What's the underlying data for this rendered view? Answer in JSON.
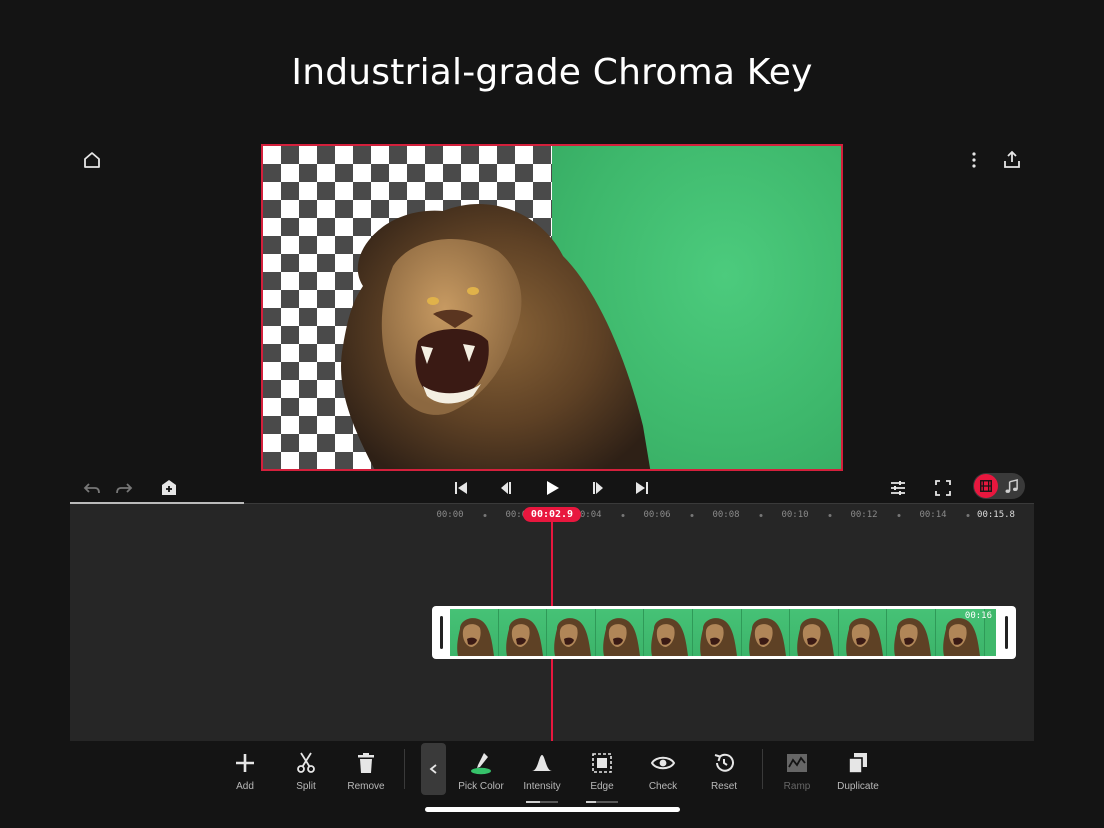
{
  "headline": "Industrial-grade Chroma Key",
  "timeline": {
    "ticks": [
      "00:00",
      "00:02",
      "00:04",
      "00:06",
      "00:08",
      "00:10",
      "00:12",
      "00:14"
    ],
    "end_time": "00:15.8",
    "playhead_time": "00:02.9",
    "progress": 0.18
  },
  "clip": {
    "duration_label": "00:16",
    "frame_count": 11
  },
  "toolbar": {
    "add": "Add",
    "split": "Split",
    "remove": "Remove",
    "pick_color": "Pick Color",
    "intensity": "Intensity",
    "edge": "Edge",
    "check": "Check",
    "reset": "Reset",
    "ramp": "Ramp",
    "duplicate": "Duplicate",
    "intensity_level": 0.45,
    "edge_level": 0.3
  },
  "colors": {
    "accent": "#e8173e",
    "key_green": "#44c174",
    "background": "#141414",
    "panel": "#262626"
  },
  "icons": {
    "home": "home-icon",
    "more": "more-vertical-icon",
    "share": "share-icon",
    "undo": "undo-icon",
    "redo": "redo-icon",
    "add_layer": "add-layer-icon",
    "skip_start": "skip-start-icon",
    "prev_frame": "prev-frame-icon",
    "play": "play-icon",
    "next_frame": "next-frame-icon",
    "skip_end": "skip-end-icon",
    "adjust": "adjust-icon",
    "fullscreen": "fullscreen-icon",
    "video_mode": "film-icon",
    "audio_mode": "music-note-icon"
  }
}
